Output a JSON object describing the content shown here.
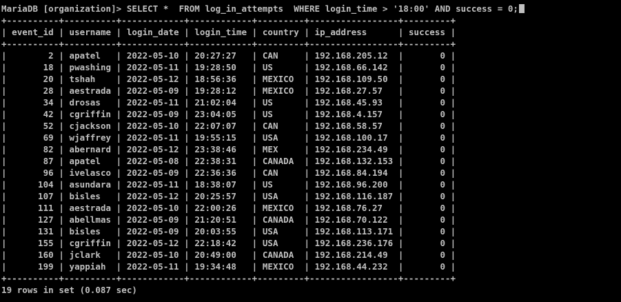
{
  "terminal": {
    "prompt": "MariaDB [organization]> ",
    "command": "SELECT *  FROM log_in_attempts  WHERE login_time > '18:00' AND success = 0;",
    "summary": "19 rows in set (0.087 sec)"
  },
  "table": {
    "columns": [
      "event_id",
      "username",
      "login_date",
      "login_time",
      "country",
      "ip_address",
      "success"
    ],
    "rows": [
      [
        "2",
        "apatel",
        "2022-05-10",
        "20:27:27",
        "CAN",
        "192.168.205.12",
        "0"
      ],
      [
        "18",
        "pwashing",
        "2022-05-11",
        "19:28:50",
        "US",
        "192.168.66.142",
        "0"
      ],
      [
        "20",
        "tshah",
        "2022-05-12",
        "18:56:36",
        "MEXICO",
        "192.168.109.50",
        "0"
      ],
      [
        "28",
        "aestrada",
        "2022-05-09",
        "19:28:12",
        "MEXICO",
        "192.168.27.57",
        "0"
      ],
      [
        "34",
        "drosas",
        "2022-05-11",
        "21:02:04",
        "US",
        "192.168.45.93",
        "0"
      ],
      [
        "42",
        "cgriffin",
        "2022-05-09",
        "23:04:05",
        "US",
        "192.168.4.157",
        "0"
      ],
      [
        "52",
        "cjackson",
        "2022-05-10",
        "22:07:07",
        "CAN",
        "192.168.58.57",
        "0"
      ],
      [
        "69",
        "wjaffrey",
        "2022-05-11",
        "19:55:15",
        "USA",
        "192.168.100.17",
        "0"
      ],
      [
        "82",
        "abernard",
        "2022-05-12",
        "23:38:46",
        "MEX",
        "192.168.234.49",
        "0"
      ],
      [
        "87",
        "apatel",
        "2022-05-08",
        "22:38:31",
        "CANADA",
        "192.168.132.153",
        "0"
      ],
      [
        "96",
        "ivelasco",
        "2022-05-09",
        "22:36:36",
        "CAN",
        "192.168.84.194",
        "0"
      ],
      [
        "104",
        "asundara",
        "2022-05-11",
        "18:38:07",
        "US",
        "192.168.96.200",
        "0"
      ],
      [
        "107",
        "bisles",
        "2022-05-12",
        "20:25:57",
        "USA",
        "192.168.116.187",
        "0"
      ],
      [
        "111",
        "aestrada",
        "2022-05-10",
        "22:00:26",
        "MEXICO",
        "192.168.76.27",
        "0"
      ],
      [
        "127",
        "abellmas",
        "2022-05-09",
        "21:20:51",
        "CANADA",
        "192.168.70.122",
        "0"
      ],
      [
        "131",
        "bisles",
        "2022-05-09",
        "20:03:55",
        "USA",
        "192.168.113.171",
        "0"
      ],
      [
        "155",
        "cgriffin",
        "2022-05-12",
        "22:18:42",
        "USA",
        "192.168.236.176",
        "0"
      ],
      [
        "160",
        "jclark",
        "2022-05-10",
        "20:49:00",
        "CANADA",
        "192.168.214.49",
        "0"
      ],
      [
        "199",
        "yappiah",
        "2022-05-11",
        "19:34:48",
        "MEXICO",
        "192.168.44.232",
        "0"
      ]
    ]
  },
  "colors": {
    "background": "#000000",
    "text": "#c0c0c0"
  }
}
